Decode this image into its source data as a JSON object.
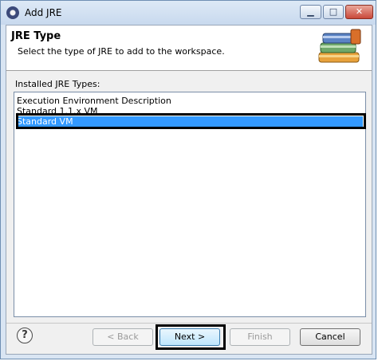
{
  "window": {
    "title": "Add JRE",
    "controls": {
      "minimize": "▁",
      "maximize": "□",
      "close": "✕"
    }
  },
  "header": {
    "title": "JRE Type",
    "description": "Select the type of JRE to add to the workspace."
  },
  "list": {
    "label": "Installed JRE Types:",
    "items": [
      "Execution Environment Description",
      "Standard 1.1.x VM",
      "Standard VM"
    ],
    "selected": "Standard VM"
  },
  "buttons": {
    "help": "?",
    "back": "< Back",
    "next": "Next >",
    "finish": "Finish",
    "cancel": "Cancel"
  },
  "colors": {
    "selection": "#3399ff",
    "title_bar": "#c8d9ee",
    "close_button": "#c9483a"
  }
}
